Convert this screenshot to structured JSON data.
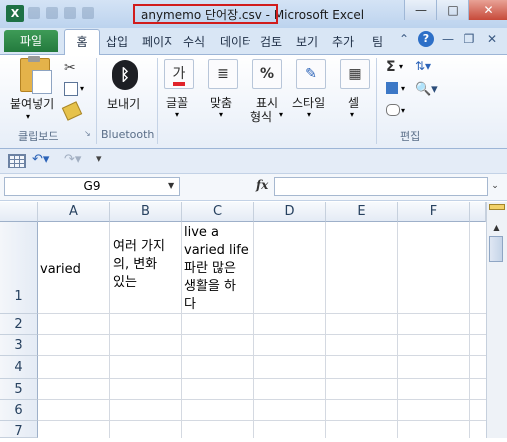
{
  "window": {
    "title": "anymemo 단어장.csv - Microsoft Excel",
    "minimize": "—",
    "maximize": "□",
    "close": "✕"
  },
  "tabs": {
    "file": "파일",
    "home": "홈",
    "items": [
      "삽입",
      "페이지",
      "수식",
      "데이터",
      "검토",
      "보기",
      "추가",
      "팀"
    ]
  },
  "ribbon": {
    "paste": "붙여넣기",
    "bluetooth": "보내기",
    "font": "글꼴",
    "alignment": "맞춤",
    "number_line1": "표시",
    "number_line2": "형식",
    "styles": "스타일",
    "cells": "셀",
    "groups": {
      "clipboard": "클립보드",
      "bluetooth": "Bluetooth",
      "editing": "편집"
    }
  },
  "formula_bar": {
    "name_box": "G9",
    "fx": "fx",
    "value": ""
  },
  "sheet": {
    "columns": [
      "A",
      "B",
      "C",
      "D",
      "E",
      "F"
    ],
    "rows": [
      "1",
      "2",
      "3",
      "4",
      "5",
      "6",
      "7"
    ],
    "cells": {
      "A1": "varied",
      "B1_line1": "여러 가지",
      "B1_line2": "의, 변화",
      "B1_line3": "있는",
      "C1_line1": "live a",
      "C1_line2": "varied life",
      "C1_line3": "파란 많은",
      "C1_line4": "생활을 하",
      "C1_line5": "다"
    }
  }
}
